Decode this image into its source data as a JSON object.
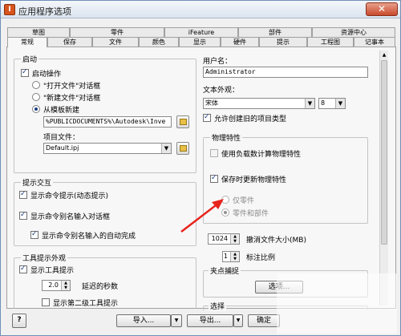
{
  "window": {
    "title": "应用程序选项",
    "close_glyph": "✕"
  },
  "tabs_row1": [
    "草图",
    "零件",
    "iFeature",
    "部件",
    "资源中心"
  ],
  "tabs_row2": [
    "常规",
    "保存",
    "文件",
    "颜色",
    "显示",
    "硬件",
    "提示",
    "工程图",
    "记事本"
  ],
  "startup": {
    "title": "启动",
    "startup_action": "启动操作",
    "open_dialog": "\"打开文件\"对话框",
    "new_dialog": "\"新建文件\"对话框",
    "from_template": "从模板新建",
    "template_path": "%PUBLICDOCUMENTS%\\Autodesk\\Inve",
    "project_label": "项目文件：",
    "project_value": "Default.ipj"
  },
  "prompt": {
    "title": "提示交互",
    "show_command_prompt": "显示命令提示(动态提示)",
    "show_alias_dialog": "显示命令别名输入对话框",
    "show_alias_autocomplete": "显示命令别名输入的自动完成"
  },
  "tooltip": {
    "title": "工具提示外观",
    "show_tooltips": "显示工具提示",
    "delay_value": "2.0",
    "delay_label": "延迟的秒数",
    "show_second_level": "显示第二级工具提示"
  },
  "user": {
    "title": "用户名：",
    "value": "Administrator"
  },
  "text_appearance": {
    "title": "文本外观：",
    "font": "宋体",
    "size": "8",
    "allow_type": "允许创建旧的项目类型"
  },
  "physical": {
    "title": "物理特性",
    "use_previous": "使用负载数计算物理特性",
    "update_on_save": "保存时更新物理特性",
    "parts_only": "仅零件",
    "parts_and_assemblies": "零件和部件"
  },
  "undo": {
    "size_value": "1024",
    "size_label": "撤消文件大小(MB)",
    "scale_value": "1",
    "scale_label": "标注比例"
  },
  "selection": {
    "title": "夹点捕捉",
    "button": "选项..."
  },
  "selection2": {
    "title": "选择"
  },
  "footer": {
    "help": "?",
    "import": "导入...",
    "export": "导出...",
    "ok": "确定"
  }
}
